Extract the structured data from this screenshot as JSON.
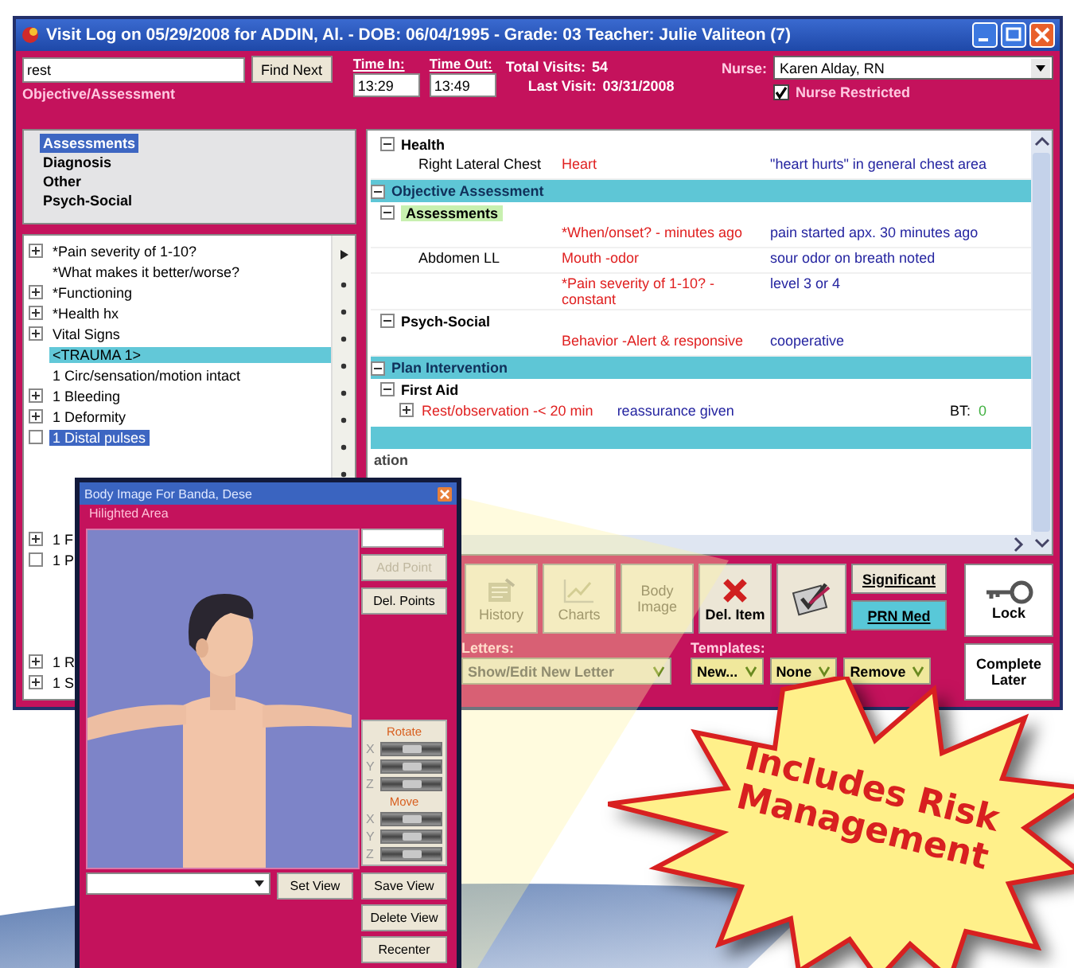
{
  "window": {
    "title": "Visit Log on 05/29/2008 for ADDIN, Al. - DOB: 06/04/1995 - Grade: 03   Teacher: Julie Valiteon (7)"
  },
  "search": {
    "value": "rest",
    "button": "Find Next"
  },
  "section_label": "Objective/Assessment",
  "times": [
    {
      "label": "Time In:",
      "value": "13:29"
    },
    {
      "label": "Time Out:",
      "value": "13:49"
    }
  ],
  "visits": [
    {
      "label": "Total Visits:",
      "value": "54"
    },
    {
      "label": "Last Visit:",
      "value": "03/31/2008"
    }
  ],
  "nurse": {
    "label": "Nurse:",
    "value": "Karen Alday, RN"
  },
  "nurse_restricted": {
    "label": "Nurse Restricted",
    "checked": true
  },
  "categories": [
    {
      "label": "Assessments",
      "selected": true
    },
    {
      "label": "Diagnosis",
      "selected": false
    },
    {
      "label": "Other",
      "selected": false
    },
    {
      "label": "Psych-Social",
      "selected": false
    }
  ],
  "question_groups": [
    [
      {
        "label": "*Pain severity of 1-10?",
        "kind": "expander",
        "selected": false
      },
      {
        "label": "*What makes it better/worse?",
        "kind": "plain",
        "selected": false
      },
      {
        "label": "*Functioning",
        "kind": "expander",
        "selected": false
      },
      {
        "label": "*Health hx",
        "kind": "expander",
        "selected": false
      },
      {
        "label": "Vital Signs",
        "kind": "expander",
        "selected": false
      },
      {
        "label": "<TRAUMA 1>",
        "kind": "header",
        "selected": false
      },
      {
        "label": "1 Circ/sensation/motion intact",
        "kind": "plain",
        "selected": false
      },
      {
        "label": "1 Bleeding",
        "kind": "expander",
        "selected": false
      },
      {
        "label": "1 Deformity",
        "kind": "expander",
        "selected": false
      },
      {
        "label": "1 Distal pulses",
        "kind": "checkbox",
        "checked": false,
        "selected": true
      }
    ],
    [
      {
        "label": "1 F",
        "kind": "expander",
        "selected": false
      },
      {
        "label": "1 P",
        "kind": "checkbox",
        "checked": false,
        "selected": false
      }
    ],
    [
      {
        "label": "1 R",
        "kind": "expander",
        "selected": false
      },
      {
        "label": "1 S",
        "kind": "expander",
        "selected": false
      }
    ]
  ],
  "log": [
    {
      "kind": "group",
      "label": "Health",
      "expanded": true
    },
    {
      "kind": "entry",
      "location": "Right Lateral Chest",
      "finding": "Heart",
      "note": "\"heart hurts\" in general chest area"
    },
    {
      "kind": "section",
      "label": "Objective Assessment",
      "expanded": true
    },
    {
      "kind": "group",
      "label": "Assessments",
      "expanded": true,
      "highlighted": true
    },
    {
      "kind": "entry",
      "finding": "*When/onset? -   minutes ago",
      "note": "pain started apx. 30 minutes ago"
    },
    {
      "kind": "entry",
      "location": "Abdomen LL",
      "finding": "Mouth -odor",
      "note": "sour odor on breath noted"
    },
    {
      "kind": "entry",
      "finding": "*Pain severity of 1-10? -constant",
      "note": "level 3 or 4"
    },
    {
      "kind": "group",
      "label": "Psych-Social",
      "expanded": true
    },
    {
      "kind": "entry",
      "finding": "Behavior -Alert & responsive",
      "note": "cooperative"
    },
    {
      "kind": "section",
      "label": "Plan Intervention",
      "expanded": true
    },
    {
      "kind": "group",
      "label": "First Aid",
      "expanded": true
    },
    {
      "kind": "action",
      "expanded": false,
      "finding": "Rest/observation -< 20 min",
      "note": "reassurance given",
      "extra_label": "BT:",
      "extra_value": "0"
    },
    {
      "kind": "bar"
    },
    {
      "kind": "partial",
      "label": "ation"
    }
  ],
  "toolbar": [
    {
      "kind": "history",
      "label": "History",
      "disabled": true
    },
    {
      "kind": "charts",
      "label": "Charts",
      "disabled": true
    },
    {
      "kind": "text",
      "label": "Body Image",
      "disabled": true
    },
    {
      "kind": "delete",
      "label": "Del. Item",
      "disabled": false
    },
    {
      "kind": "edit",
      "disabled": false
    }
  ],
  "flags": [
    {
      "label": "Significant",
      "on": false
    },
    {
      "label": "PRN Med",
      "on": true
    }
  ],
  "lock": {
    "label": "Lock"
  },
  "complete": {
    "label": "Complete Later"
  },
  "letters": {
    "label": "Letters:",
    "value": "Show/Edit New Letter"
  },
  "templates": {
    "label": "Templates:",
    "items": [
      "New...",
      "None",
      "Remove"
    ]
  },
  "body_window": {
    "title": "Body Image For Banda, Dese",
    "subtitle": "Hilighted Area",
    "add_point": {
      "label": "Add Point",
      "disabled": true
    },
    "del_points": {
      "label": "Del. Points"
    },
    "rotate": {
      "label": "Rotate",
      "axes": [
        {
          "label": "X",
          "level": 0.5
        },
        {
          "label": "Y",
          "level": 0.5
        },
        {
          "label": "Z",
          "level": 0.5
        }
      ]
    },
    "move": {
      "label": "Move",
      "axes": [
        {
          "label": "X",
          "level": 0.5
        },
        {
          "label": "Y",
          "level": 0.5
        },
        {
          "label": "Z",
          "level": 0.5
        }
      ]
    },
    "set_view": "Set View",
    "buttons": [
      "Save View",
      "Delete View",
      "Recenter"
    ]
  },
  "callout": {
    "text": "Includes Risk Management"
  }
}
